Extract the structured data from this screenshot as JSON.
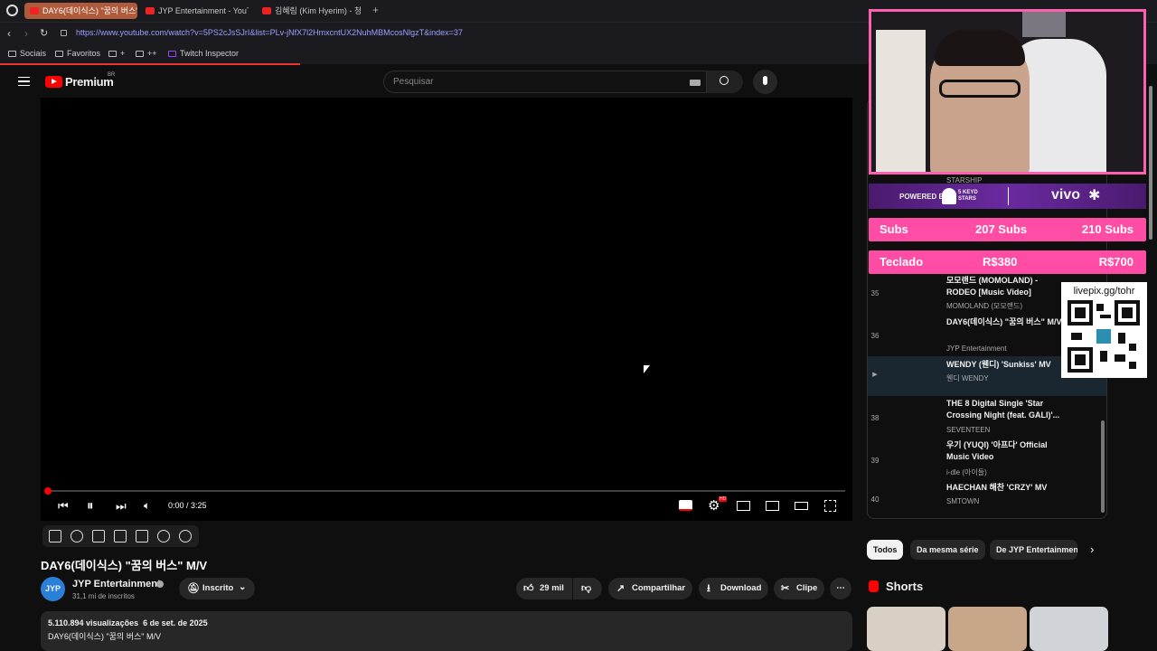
{
  "browser": {
    "tabs": [
      {
        "label": "DAY6(데이식스) \"꿈의 버스\"",
        "active": true
      },
      {
        "label": "JYP Entertainment - YouT",
        "active": false
      },
      {
        "label": "김혜림 (Kim Hyerim) - 청",
        "active": false
      }
    ],
    "new_tab_symbol": "+",
    "url": "https://www.youtube.com/watch?v=5PS2cJsSJrI&list=PLv-jNfX7l2HmxcntUX2NuhMBMcosNlgzT&index=37",
    "bookmarks": [
      "Sociais",
      "Favoritos",
      "+",
      "++",
      "Twitch Inspector"
    ]
  },
  "youtube": {
    "logo_text": "Premium",
    "logo_region": "BR",
    "search_placeholder": "Pesquisar",
    "player": {
      "time": "0:00 / 3:25",
      "progress_fraction": 0.0,
      "hd_badge": "HD"
    },
    "video_title": "DAY6(데이식스) \"꿈의 버스\" M/V",
    "channel": {
      "name": "JYP Entertainment",
      "avatar_text": "JYP",
      "subscribers": "31,1 mi de inscritos",
      "subscribed_label": "Inscrito"
    },
    "actions": {
      "likes": "29 mil",
      "share": "Compartilhar",
      "download": "Download",
      "clip": "Clipe",
      "more": "⋯"
    },
    "description": {
      "stats": "5.110.894 visualizações  6 de set. de 2025",
      "text": "DAY6(데이식스) \"꿈의 버스\" M/V"
    },
    "playlist": [
      {
        "num": "35",
        "title": "모모랜드 (MOMOLAND) - RODEO [Music Video]",
        "channel": "MOMOLAND (모모랜드)",
        "playing": false
      },
      {
        "num": "36",
        "title": "DAY6(데이식스) \"꿈의 버스\" M/V",
        "channel": "JYP Entertainment",
        "playing": false
      },
      {
        "num": "▶",
        "title": "WENDY (웬디) 'Sunkiss' MV",
        "channel": "웬디 WENDY",
        "playing": true
      },
      {
        "num": "38",
        "title": "THE 8 Digital Single 'Star Crossing Night (feat. GALI)'...",
        "channel": "SEVENTEEN",
        "playing": false
      },
      {
        "num": "39",
        "title": "우기 (YUQI) '아프다' Official Music Video",
        "channel": "i-dle (아이들)",
        "playing": false
      },
      {
        "num": "40",
        "title": "HAECHAN 해찬 'CRZY' MV",
        "channel": "SMTOWN",
        "playing": false
      }
    ],
    "playlist_partial_channel": "STARSHIP",
    "chips": [
      "Todos",
      "Da mesma série",
      "De JYP Entertainment"
    ],
    "shorts_title": "Shorts"
  },
  "overlay": {
    "sponsor_text": "POWERED BY",
    "sponsor_brand": "5 KEYD STARS",
    "sponsor_partner": "vivo",
    "goals": [
      {
        "label": "Subs",
        "current": "207 Subs",
        "target": "210 Subs"
      },
      {
        "label": "Teclado",
        "current": "R$380",
        "target": "R$700"
      }
    ],
    "qr_text": "livepix.gg/tohr"
  },
  "colors": {
    "accent_red": "#ff0000",
    "overlay_pink": "#ff4da6",
    "sponsor_purple": "#6a2aa0"
  }
}
